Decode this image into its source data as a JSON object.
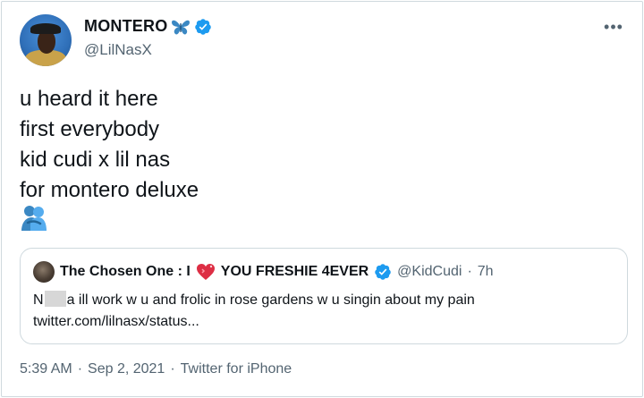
{
  "tweet": {
    "display_name": "MONTERO",
    "handle": "@LilNasX",
    "more_label": "•••",
    "lines": [
      "u heard it here",
      "first everybody",
      "kid cudi x lil nas",
      "for montero deluxe"
    ],
    "emoji": "people-hugging-icon"
  },
  "quote": {
    "name_part1": "The Chosen One : I",
    "name_part2": "YOU FRESHIE 4EVER",
    "handle": "@KidCudi",
    "separator": "·",
    "time": "7h",
    "text_start": "N",
    "text_rest": "a ill work w u and frolic in rose gardens w u singin about my pain",
    "link": "twitter.com/lilnasx/status..."
  },
  "meta": {
    "time": "5:39 AM",
    "sep1": "·",
    "date": "Sep 2, 2021",
    "sep2": "·",
    "source": "Twitter for iPhone"
  },
  "colors": {
    "verified": "#1d9bf0",
    "secondary_text": "#536471",
    "border": "#cfd9de",
    "hug_emoji": "#3b88c3"
  }
}
